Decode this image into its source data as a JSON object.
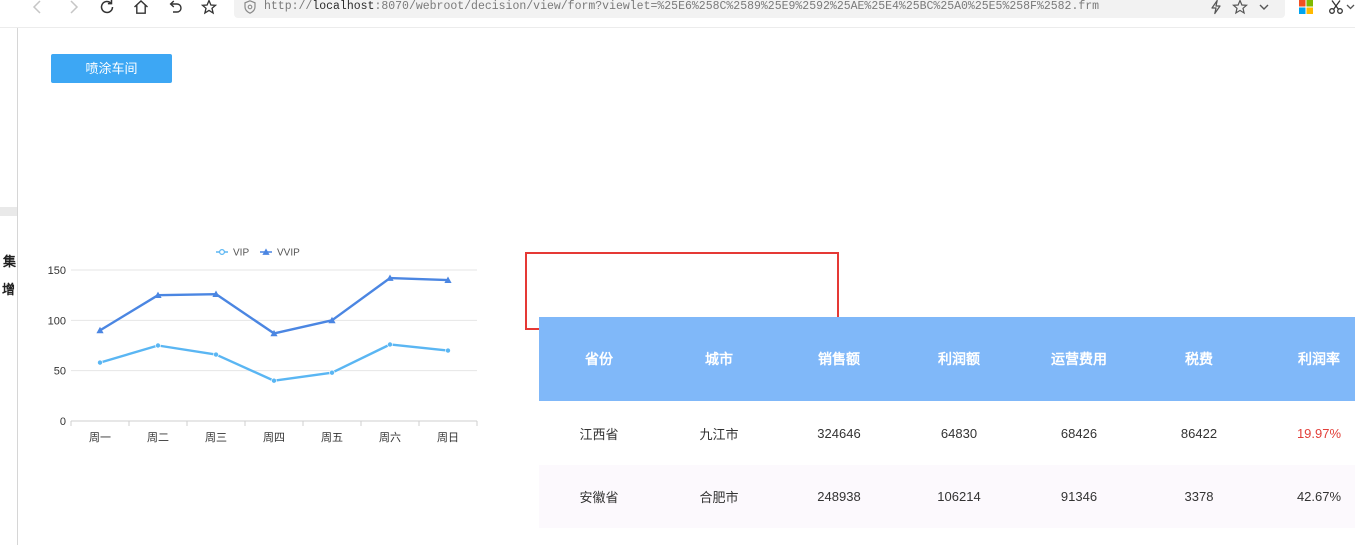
{
  "browser": {
    "nav_icons": [
      "back-icon",
      "forward-icon",
      "refresh-icon",
      "home-icon",
      "undo-icon",
      "favorite-star-icon"
    ],
    "url": {
      "scheme": "http://",
      "host": "localhost",
      "path": ":8070/webroot/decision/view/form?viewlet=%25E6%258C%2589%25E9%2592%25AE%25E4%25BC%25A0%25E5%258F%2582.frm"
    },
    "address_icons": [
      "shield-icon",
      "lightning-icon",
      "star-icon",
      "chevron-down-icon"
    ],
    "extension_icons": [
      "windows-logo-icon",
      "scissors-icon",
      "chevron-down-icon"
    ]
  },
  "side_panel": {
    "items": [
      "集",
      "增"
    ]
  },
  "toolbar": {
    "workshop_button_label": "喷涂车间"
  },
  "chart_data": {
    "type": "line",
    "categories": [
      "周一",
      "周二",
      "周三",
      "周四",
      "周五",
      "周六",
      "周日"
    ],
    "series": [
      {
        "name": "VIP",
        "values": [
          58,
          75,
          66,
          40,
          48,
          76,
          70
        ],
        "color": "#5ab6f3",
        "marker": "circle"
      },
      {
        "name": "VVIP",
        "values": [
          90,
          125,
          126,
          87,
          100,
          142,
          140
        ],
        "color": "#4b86e2",
        "marker": "triangle"
      }
    ],
    "ylim": [
      0,
      150
    ],
    "yticks": [
      0,
      50,
      100,
      150
    ],
    "grid": true,
    "legend": "top-center"
  },
  "table": {
    "headers": [
      "省份",
      "城市",
      "销售额",
      "利润额",
      "运营费用",
      "税费",
      "利润率"
    ],
    "rows": [
      [
        "江西省",
        "九江市",
        "324646",
        "64830",
        "68426",
        "86422",
        "19.97%"
      ],
      [
        "安徽省",
        "合肥市",
        "248938",
        "106214",
        "91346",
        "3378",
        "42.67%"
      ]
    ]
  },
  "colors": {
    "button_bg": "#3da7f4",
    "table_header_bg": "#80b8f9",
    "highlight_text": "#e2403a",
    "annotation_box": "#e53935"
  }
}
